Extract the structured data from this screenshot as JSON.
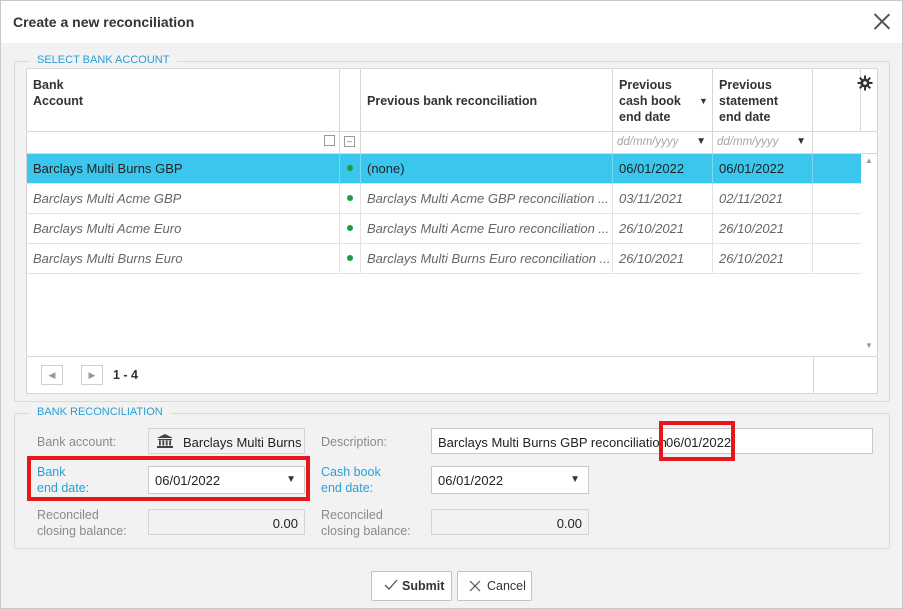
{
  "dialog": {
    "title": "Create a new reconciliation"
  },
  "select_section": {
    "legend": "SELECT BANK ACCOUNT",
    "columns": {
      "bank_account_line1": "Bank",
      "bank_account_line2": "Account",
      "previous_reconciliation": "Previous bank reconciliation",
      "prev_cash_line1": "Previous",
      "prev_cash_line2": "cash book",
      "prev_cash_line3": "end date",
      "prev_stmt_line1": "Previous",
      "prev_stmt_line2": "statement",
      "prev_stmt_line3": "end date"
    },
    "filters": {
      "date_placeholder_1": "dd/mm/yyyy",
      "date_placeholder_2": "dd/mm/yyyy"
    },
    "rows": [
      {
        "account": "Barclays Multi Burns GBP",
        "previous": "(none)",
        "cash_end": "06/01/2022",
        "stmt_end": "06/01/2022",
        "selected": true
      },
      {
        "account": "Barclays Multi Acme GBP",
        "previous": "Barclays Multi Acme GBP reconciliation ...",
        "cash_end": "03/11/2021",
        "stmt_end": "02/11/2021",
        "selected": false
      },
      {
        "account": "Barclays Multi Acme Euro",
        "previous": "Barclays Multi Acme Euro reconciliation ...",
        "cash_end": "26/10/2021",
        "stmt_end": "26/10/2021",
        "selected": false
      },
      {
        "account": "Barclays Multi Burns Euro",
        "previous": "Barclays Multi Burns Euro reconciliation ...",
        "cash_end": "26/10/2021",
        "stmt_end": "26/10/2021",
        "selected": false
      }
    ],
    "pager": {
      "range": "1 - 4"
    }
  },
  "reconciliation_section": {
    "legend": "BANK RECONCILIATION",
    "bank_account_label": "Bank account:",
    "bank_account_value": "Barclays Multi Burns GBP",
    "description_label": "Description:",
    "description_value": "Barclays Multi Burns GBP reconciliation",
    "description_date": "06/01/2022",
    "bank_end_date_label_1": "Bank",
    "bank_end_date_label_2": "end date:",
    "bank_end_date_value": "06/01/2022",
    "cash_book_end_date_label_1": "Cash book",
    "cash_book_end_date_label_2": "end date:",
    "cash_book_end_date_value": "06/01/2022",
    "reconciled_label_1": "Reconciled",
    "reconciled_label_2": "closing balance:",
    "reconciled_bank_value": "0.00",
    "reconciled_cash_value": "0.00"
  },
  "buttons": {
    "submit": "Submit",
    "cancel": "Cancel"
  },
  "colors": {
    "accent": "#2a9fd6",
    "selected_row": "#3bc6ee",
    "highlight": "#e8161a"
  }
}
